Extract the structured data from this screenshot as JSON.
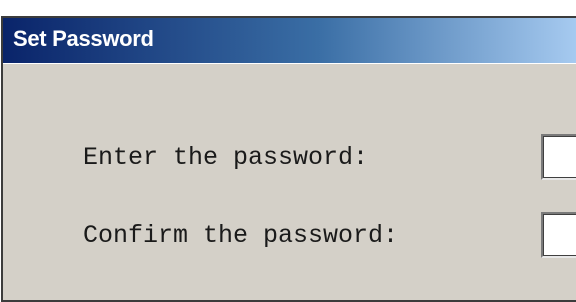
{
  "window": {
    "title": "Set Password"
  },
  "form": {
    "password_label": "Enter the password:",
    "password_value": "",
    "confirm_label": "Confirm the password:",
    "confirm_value": ""
  },
  "colors": {
    "titlebar_start": "#0a246a",
    "titlebar_end": "#a6caf0",
    "dialog_face": "#d4d0c8"
  }
}
